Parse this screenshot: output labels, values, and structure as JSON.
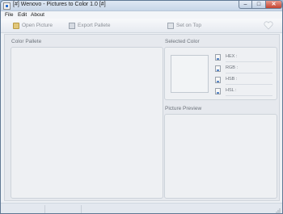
{
  "window": {
    "title": "[#] Wenovo - Pictures to Color 1.0 [#]",
    "minimize_glyph": "–",
    "maximize_glyph": "□",
    "close_glyph": "✕"
  },
  "menu": {
    "file": "File",
    "edit": "Edit",
    "about": "About"
  },
  "toolbar": {
    "open_label": "Open Picture",
    "export_label": "Export Pallete",
    "ontop_label": "Set on Top",
    "open_icon": "folder-icon",
    "export_icon": "export-icon",
    "ontop_icon": "pin-icon",
    "right_icon": "heart-icon"
  },
  "panels": {
    "pallete_title": "Color Pallete",
    "selected_title": "Selected Color",
    "preview_title": "Picture Preview"
  },
  "color_values": {
    "hex_label": "HEX :",
    "rgb_label": "RGB :",
    "hsb_label": "HSB :",
    "hsl_label": "HSL :"
  },
  "colors": {
    "accent": "#2a6fd1",
    "close_button": "#c4432f"
  }
}
